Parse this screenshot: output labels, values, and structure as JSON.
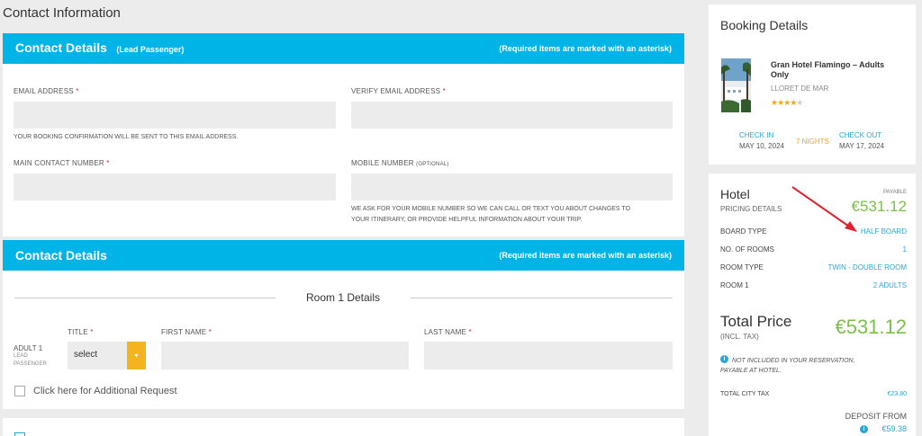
{
  "page_title": "Contact Information",
  "contact1": {
    "title": "Contact Details",
    "subtitle": "(Lead Passenger)",
    "required_note": "(Required items are marked with an asterisk)",
    "email_label": "EMAIL ADDRESS",
    "verify_email_label": "VERIFY EMAIL ADDRESS",
    "email_help": "YOUR BOOKING CONFIRMATION WILL BE SENT TO THIS EMAIL ADDRESS.",
    "main_contact_label": "MAIN CONTACT NUMBER",
    "mobile_label": "MOBILE NUMBER",
    "mobile_optional": "(OPTIONAL)",
    "mobile_help_1": "WE ASK FOR YOUR MOBILE NUMBER SO WE CAN CALL OR TEXT YOU ABOUT CHANGES TO",
    "mobile_help_2": "YOUR ITINERARY, OR PROVIDE HELPFUL INFORMATION ABOUT YOUR TRIP.",
    "asterisk": "*"
  },
  "contact2": {
    "title": "Contact Details",
    "required_note": "(Required items are marked with an asterisk)",
    "room_heading": "Room 1 Details",
    "title_label": "TITLE",
    "first_name_label": "FIRST NAME",
    "last_name_label": "LAST NAME",
    "adult_label": "ADULT 1",
    "lead_label_1": "LEAD",
    "lead_label_2": "PASSENGER",
    "select_value": "select",
    "additional_request": "Click here for Additional Request"
  },
  "booking": {
    "title": "Booking Details",
    "hotel_name_1": "Gran Hotel Flamingo – Adults",
    "hotel_name_2": "Only",
    "location": "LLORET DE MAR",
    "stars": "★★★★",
    "star_empty": "★",
    "check_in_label": "CHECK IN",
    "check_in_date": "MAY 10, 2024",
    "nights": "7 NIGHTS",
    "check_out_label": "CHECK OUT",
    "check_out_date": "MAY 17, 2024"
  },
  "pricing": {
    "hotel_label": "Hotel",
    "pricing_details": "PRICING DETAILS",
    "payable_label": "PAYABLE",
    "payable_amount": "€531.12",
    "rows": [
      {
        "label": "BOARD TYPE",
        "value": "HALF BOARD"
      },
      {
        "label": "NO. OF ROOMS",
        "value": "1"
      },
      {
        "label": "ROOM TYPE",
        "value": "TWIN - DOUBLE ROOM"
      },
      {
        "label": "ROOM 1",
        "value": "2 ADULTS"
      }
    ],
    "total_label": "Total Price",
    "incl_tax": "(INCL. TAX)",
    "total_amount": "€531.12",
    "not_included_1": "NOT INCLUDED IN YOUR RESERVATION,",
    "not_included_2": "PAYABLE AT HOTEL.",
    "city_tax_label": "TOTAL CITY TAX",
    "city_tax_value": "€23.80",
    "deposit_label": "DEPOSIT FROM",
    "deposit_value": "€59.38"
  },
  "colors": {
    "accent": "#00b4e8",
    "price_green": "#7cc04a",
    "link_cyan": "#2aa7d7",
    "star_gold": "#f3a619",
    "required_red": "#e0232f",
    "annotation_red": "#e0232f"
  }
}
